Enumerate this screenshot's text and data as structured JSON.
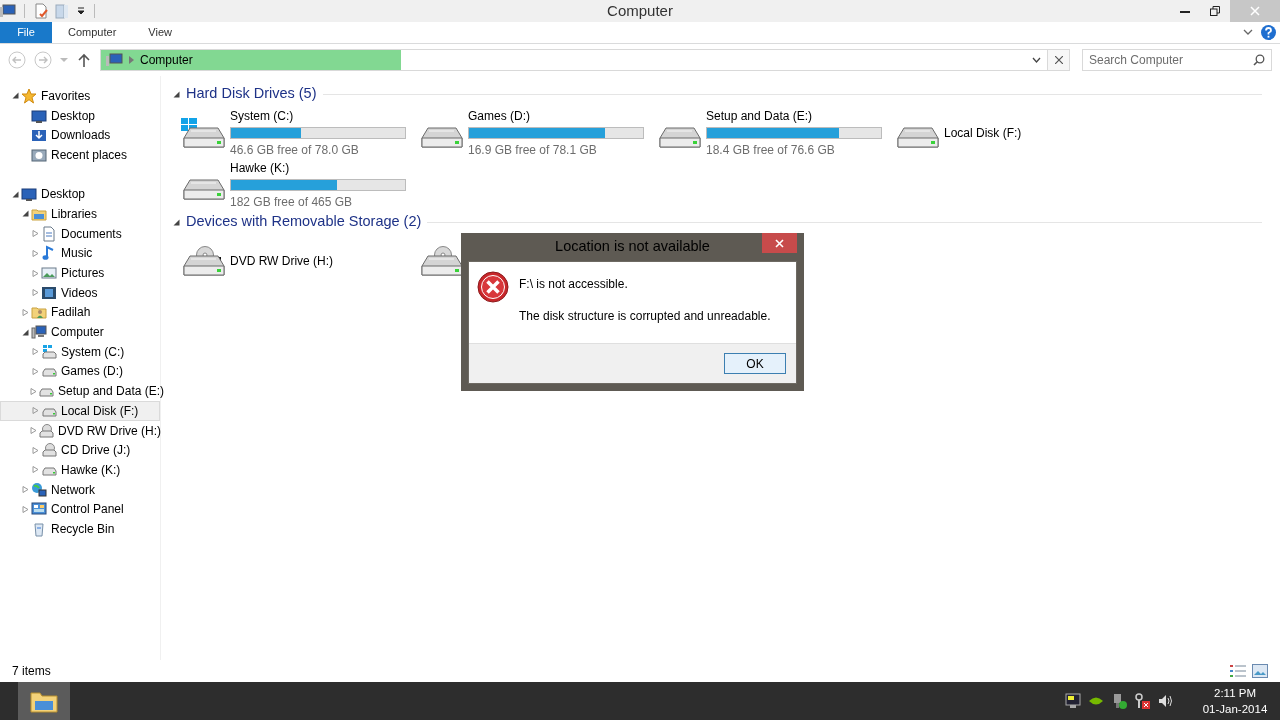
{
  "window": {
    "title": "Computer"
  },
  "ribbon": {
    "tabs": [
      {
        "label": "File",
        "kind": "file"
      },
      {
        "label": "Computer",
        "kind": "tab"
      },
      {
        "label": "View",
        "kind": "tab"
      }
    ]
  },
  "address_bar": {
    "path": [
      "Computer"
    ],
    "level": 0.31
  },
  "search": {
    "placeholder": "Search Computer"
  },
  "navigation_tree": {
    "sections": [
      {
        "items": [
          {
            "label": "Favorites",
            "kind": "star",
            "expanded": true,
            "selected": false,
            "children": [
              {
                "label": "Desktop",
                "kind": "desktop",
                "selected": false
              },
              {
                "label": "Downloads",
                "kind": "download",
                "selected": false
              },
              {
                "label": "Recent places",
                "kind": "recent",
                "selected": false
              }
            ]
          }
        ]
      },
      {
        "items": [
          {
            "label": "Desktop",
            "kind": "desktop",
            "expanded": true,
            "selected": false,
            "children": [
              {
                "label": "Libraries",
                "kind": "folder",
                "expanded": true,
                "selected": false,
                "children": [
                  {
                    "label": "Documents",
                    "kind": "document",
                    "expanded": false,
                    "selected": false
                  },
                  {
                    "label": "Music",
                    "kind": "music",
                    "expanded": false,
                    "selected": false
                  },
                  {
                    "label": "Pictures",
                    "kind": "picture",
                    "expanded": false,
                    "selected": false
                  },
                  {
                    "label": "Videos",
                    "kind": "video",
                    "expanded": false,
                    "selected": false
                  }
                ]
              },
              {
                "label": "Fadilah",
                "kind": "user",
                "expanded": false,
                "selected": false
              },
              {
                "label": "Computer",
                "kind": "computer",
                "expanded": true,
                "selected": false,
                "children": [
                  {
                    "label": "System (C:)",
                    "kind": "system",
                    "expanded": false,
                    "selected": false
                  },
                  {
                    "label": "Games (D:)",
                    "kind": "drive",
                    "expanded": false,
                    "selected": false
                  },
                  {
                    "label": "Setup and Data (E:)",
                    "kind": "drive",
                    "expanded": false,
                    "selected": false
                  },
                  {
                    "label": "Local Disk (F:)",
                    "kind": "drive",
                    "expanded": false,
                    "selected": true
                  },
                  {
                    "label": "DVD RW Drive (H:)",
                    "kind": "optical",
                    "expanded": false,
                    "selected": false
                  },
                  {
                    "label": "CD Drive (J:)",
                    "kind": "optical",
                    "expanded": false,
                    "selected": false
                  },
                  {
                    "label": "Hawke (K:)",
                    "kind": "drive",
                    "expanded": false,
                    "selected": false
                  }
                ]
              },
              {
                "label": "Network",
                "kind": "network",
                "expanded": false,
                "selected": false
              },
              {
                "label": "Control Panel",
                "kind": "control",
                "expanded": false,
                "selected": false
              },
              {
                "label": "Recycle Bin",
                "kind": "recycle",
                "selected": false
              }
            ]
          }
        ]
      }
    ]
  },
  "groups": [
    {
      "title": "Hard Disk Drives (5)",
      "expanded": true,
      "items": [
        {
          "name": "System (C:)",
          "kind": "system",
          "level": 0.4,
          "free": "46.6 GB free of 78.0 GB"
        },
        {
          "name": "Games (D:)",
          "kind": "drive",
          "level": 0.78,
          "free": "16.9 GB free of 78.1 GB"
        },
        {
          "name": "Setup and Data (E:)",
          "kind": "drive",
          "level": 0.76,
          "free": "18.4 GB free of 76.6 GB"
        },
        {
          "name": "Local Disk (F:)",
          "kind": "drive"
        },
        {
          "name": "Hawke (K:)",
          "kind": "drive",
          "level": 0.61,
          "free": "182 GB free of 465 GB"
        }
      ]
    },
    {
      "title": "Devices with Removable Storage (2)",
      "expanded": true,
      "items": [
        {
          "name": "DVD RW Drive (H:)",
          "kind": "dvd"
        },
        {
          "kind": "cd"
        }
      ]
    }
  ],
  "status_bar": {
    "item_count": "7 items"
  },
  "dialog": {
    "title": "Location is not available",
    "message": "F:\\ is not accessible.",
    "detail": "The disk structure is corrupted and unreadable.",
    "buttons": [
      "OK"
    ]
  },
  "taskbar": {
    "time": "2:11 PM",
    "date": "01-Jan-2014"
  }
}
